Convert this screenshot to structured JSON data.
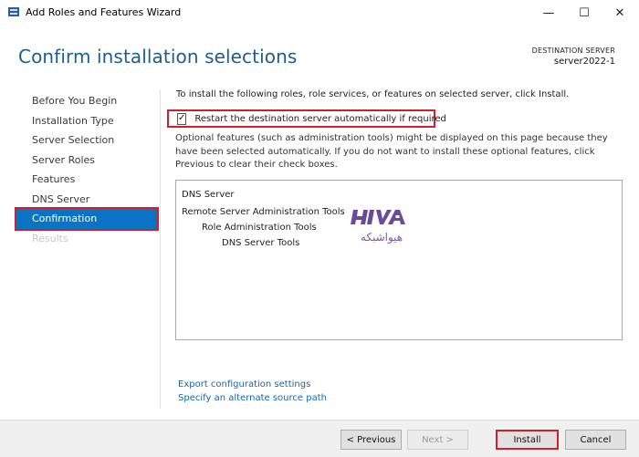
{
  "window": {
    "title": "Add Roles and Features Wizard",
    "minimize_glyph": "—",
    "maximize_glyph": "☐",
    "close_glyph": "✕"
  },
  "header": {
    "page_title": "Confirm installation selections",
    "destination_label": "DESTINATION SERVER",
    "destination_value": "server2022-1"
  },
  "sidebar": {
    "items": [
      {
        "label": "Before You Begin",
        "state": "normal"
      },
      {
        "label": "Installation Type",
        "state": "normal"
      },
      {
        "label": "Server Selection",
        "state": "normal"
      },
      {
        "label": "Server Roles",
        "state": "normal"
      },
      {
        "label": "Features",
        "state": "normal"
      },
      {
        "label": "DNS Server",
        "state": "normal"
      },
      {
        "label": "Confirmation",
        "state": "active"
      },
      {
        "label": "Results",
        "state": "disabled"
      }
    ]
  },
  "main": {
    "intro": "To install the following roles, role services, or features on selected server, click Install.",
    "restart_checkbox": {
      "label": "Restart the destination server automatically if required",
      "checked": true,
      "check_glyph": "✓"
    },
    "optional_note": "Optional features (such as administration tools) might be displayed on this page because they have been selected automatically. If you do not want to install these optional features, click Previous to clear their check boxes.",
    "selections": [
      {
        "label": "DNS Server",
        "level": 0
      },
      {
        "label": "Remote Server Administration Tools",
        "level": 0
      },
      {
        "label": "Role Administration Tools",
        "level": 1
      },
      {
        "label": "DNS Server Tools",
        "level": 2
      }
    ],
    "watermark": {
      "logo_latin": "HIVA",
      "logo_persian": "هیواشبکه"
    },
    "links": {
      "export": "Export configuration settings",
      "alternate_source": "Specify an alternate source path"
    }
  },
  "footer": {
    "previous": "< Previous",
    "next": "Next >",
    "install": "Install",
    "cancel": "Cancel"
  },
  "colors": {
    "title_blue": "#1f5d8a",
    "active_blue": "#0b73c4",
    "highlight_red": "#d0202e",
    "link_blue": "#1466b0",
    "logo_purple": "#6b4a9a"
  }
}
